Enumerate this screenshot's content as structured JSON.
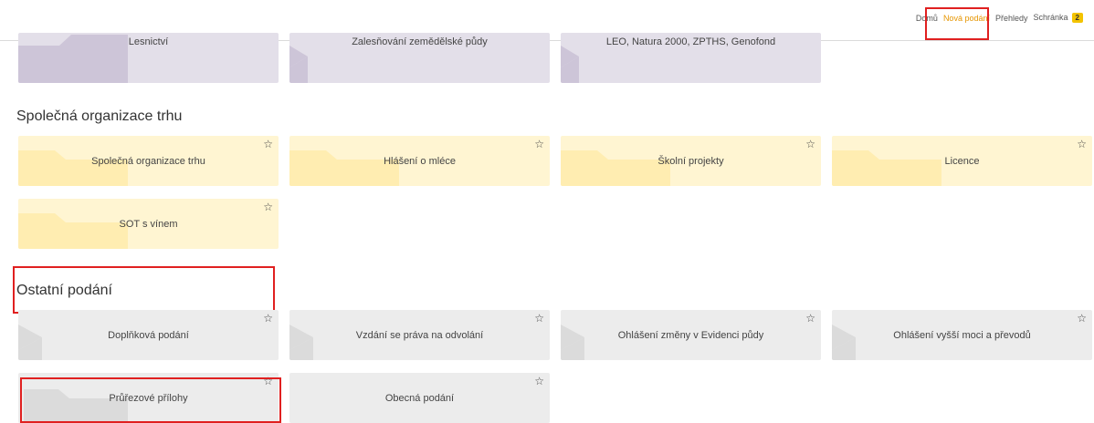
{
  "nav": {
    "items": [
      {
        "label": "Domů",
        "active": false
      },
      {
        "label": "Nová podání",
        "active": true
      },
      {
        "label": "Přehledy",
        "active": false
      },
      {
        "label": "Schránka",
        "active": false
      }
    ],
    "badge": "2"
  },
  "top_row": {
    "tiles": [
      {
        "label": "Lesnictví"
      },
      {
        "label": "Zalesňování zemědělské půdy"
      },
      {
        "label": "LEO, Natura 2000, ZPTHS, Genofond"
      }
    ]
  },
  "sections": [
    {
      "title": "Společná organizace trhu",
      "tiles": [
        {
          "label": "Společná organizace trhu",
          "star": "☆"
        },
        {
          "label": "Hlášení o mléce",
          "star": "☆"
        },
        {
          "label": "Školní projekty",
          "star": "☆"
        },
        {
          "label": "Licence",
          "star": "☆"
        },
        {
          "label": "SOT s vínem",
          "star": "☆"
        }
      ]
    },
    {
      "title": "Ostatní podání",
      "tiles": [
        {
          "label": "Doplňková podání",
          "star": "☆"
        },
        {
          "label": "Vzdání se práva na odvolání",
          "star": "☆"
        },
        {
          "label": "Ohlášení změny v Evidenci půdy",
          "star": "☆"
        },
        {
          "label": "Ohlášení vyšší moci a převodů",
          "star": "☆"
        },
        {
          "label": "Průřezové přílohy",
          "star": "☆"
        },
        {
          "label": "Obecná podání",
          "star": "☆"
        }
      ]
    }
  ],
  "colors": {
    "highlight": "#e02020",
    "active_nav": "#e69500",
    "badge": "#f3c300",
    "tile_lavender": "#e3dfe9",
    "tile_yellow": "#fff5d2",
    "tile_gray": "#ececec"
  }
}
